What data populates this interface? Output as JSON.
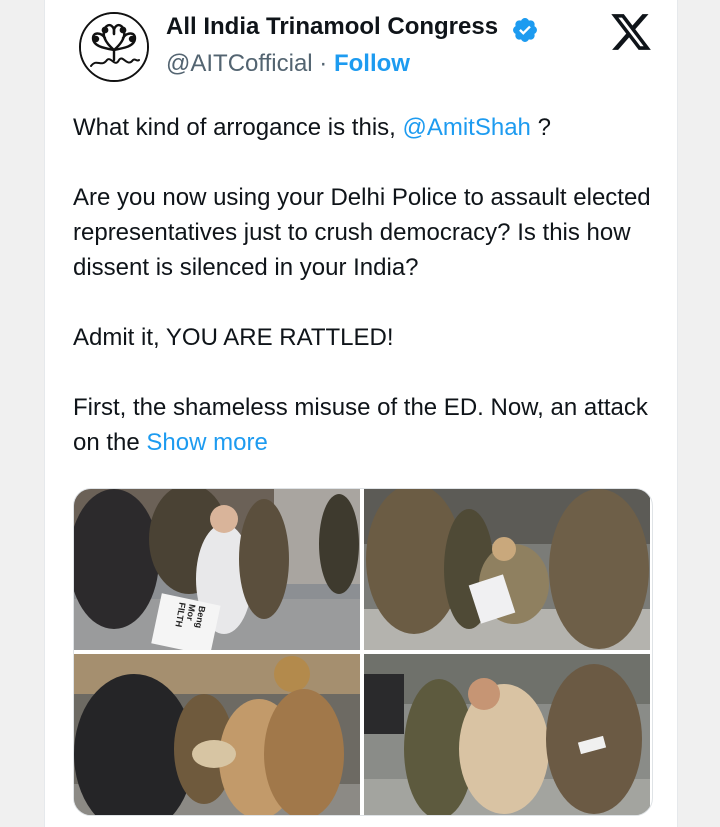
{
  "tweet": {
    "author_name": "All India Trinamool Congress",
    "handle": "@AITCofficial",
    "separator": "·",
    "follow_label": "Follow",
    "avatar_text": "Trinamool",
    "icons": {
      "verified": "verified-badge-icon",
      "platform": "x-logo-icon"
    },
    "colors": {
      "accent": "#1d9bf0",
      "text": "#0f1419",
      "secondary": "#536471"
    },
    "body": {
      "line1_prefix": "What kind of arrogance is this, ",
      "mention": "@AmitShah",
      "line1_suffix": " ?",
      "paragraph2": "Are you now using your Delhi Police to assault elected representatives just to crush democracy? Is this how dissent is silenced in your India?",
      "paragraph3": "Admit it, YOU ARE RATTLED!",
      "paragraph4": "First, the shameless misuse of the ED. Now, an attack on the ",
      "show_more": "Show more"
    },
    "media": {
      "photo1_placard": "Beng Mor FILTH"
    }
  }
}
